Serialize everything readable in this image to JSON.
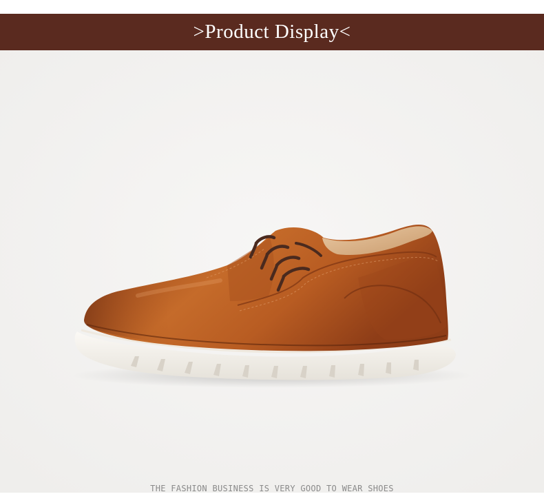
{
  "banner": {
    "title": ">Product Display<",
    "background_color": "#5a2a1f"
  },
  "product": {
    "image_subject": "shoe-photo",
    "leather_color": "#b4561f",
    "sole_color": "#f3f0ea",
    "lace_color": "#4a2a1e"
  },
  "tagline": {
    "text": "THE FASHION BUSINESS IS VERY GOOD TO WEAR SHOES"
  }
}
